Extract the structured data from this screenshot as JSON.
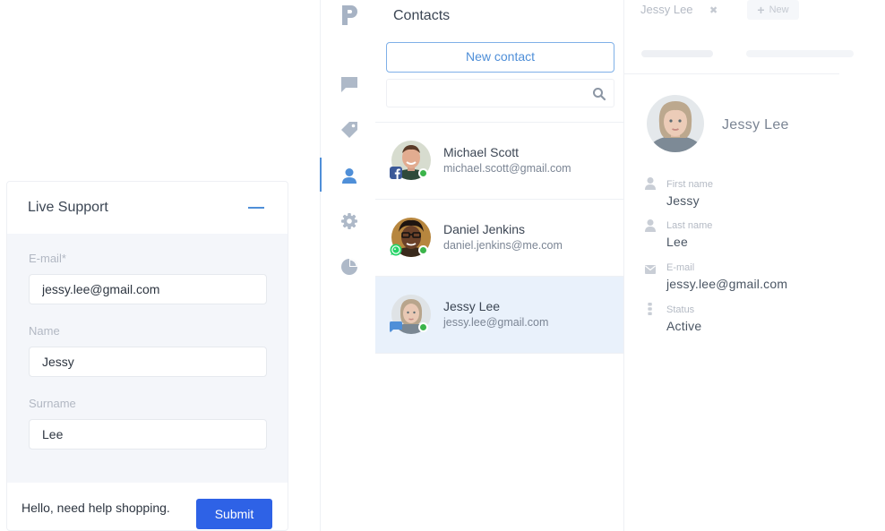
{
  "widget": {
    "title": "Live Support",
    "email_label": "E-mail*",
    "email_value": "jessy.lee@gmail.com",
    "name_label": "Name",
    "name_value": "Jessy",
    "surname_label": "Surname",
    "surname_value": "Lee",
    "message": "Hello, need help shopping.",
    "submit_label": "Submit"
  },
  "nav": {
    "items": [
      {
        "icon": "chat-icon"
      },
      {
        "icon": "tag-icon"
      },
      {
        "icon": "contacts-icon",
        "active": true
      },
      {
        "icon": "gear-icon"
      },
      {
        "icon": "pie-chart-icon"
      }
    ]
  },
  "contacts": {
    "title": "Contacts",
    "new_contact_label": "New contact",
    "search_placeholder": "",
    "items": [
      {
        "name": "Michael Scott",
        "email": "michael.scott@gmail.com",
        "channel": "facebook-icon",
        "online": true
      },
      {
        "name": "Daniel Jenkins",
        "email": "daniel.jenkins@me.com",
        "channel": "whatsapp-icon",
        "online": true
      },
      {
        "name": "Jessy Lee",
        "email": "jessy.lee@gmail.com",
        "channel": "chat-bubble-icon",
        "online": true,
        "selected": true
      }
    ]
  },
  "detail": {
    "tab_name": "Jessy Lee",
    "tab_close": "✖",
    "new_tab_label": "New",
    "profile_name": "Jessy Lee",
    "props": [
      {
        "icon": "user-icon",
        "label": "First name",
        "value": "Jessy"
      },
      {
        "icon": "user-icon",
        "label": "Last name",
        "value": "Lee"
      },
      {
        "icon": "envelope-icon",
        "label": "E-mail",
        "value": "jessy.lee@gmail.com"
      },
      {
        "icon": "status-icon",
        "label": "Status",
        "value": "Active"
      }
    ]
  },
  "colors": {
    "accent": "#4f8fd8",
    "button": "#2e62e6",
    "selected_row": "#e9f1fb",
    "online": "#3bb44a",
    "facebook": "#3b5998",
    "whatsapp": "#25d366"
  }
}
